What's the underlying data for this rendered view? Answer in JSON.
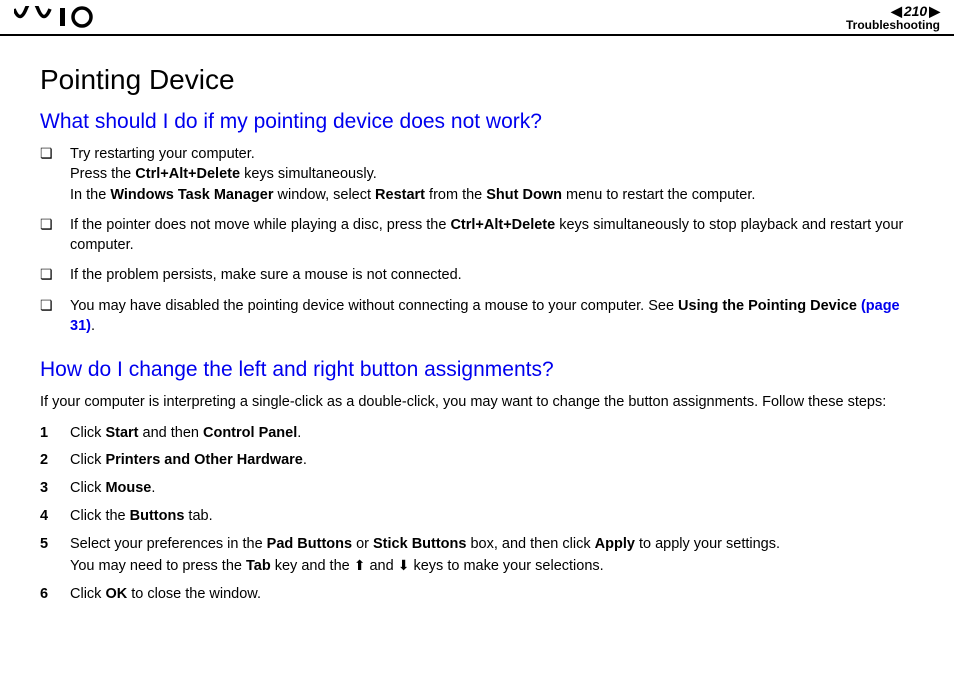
{
  "header": {
    "logo_alt": "VAIO",
    "page_number": "210",
    "section": "Troubleshooting"
  },
  "h1": "Pointing Device",
  "q1": {
    "heading": "What should I do if my pointing device does not work?",
    "items": [
      {
        "line1": "Try restarting your computer.",
        "line2_pre": "Press the ",
        "line2_b1": "Ctrl+Alt+Delete",
        "line2_post": " keys simultaneously.",
        "line3_pre": "In the ",
        "line3_b1": "Windows Task Manager",
        "line3_mid1": " window, select ",
        "line3_b2": "Restart",
        "line3_mid2": " from the ",
        "line3_b3": "Shut Down",
        "line3_post": " menu to restart the computer."
      },
      {
        "pre": "If the pointer does not move while playing a disc, press the ",
        "b1": "Ctrl+Alt+Delete",
        "post": " keys simultaneously to stop playback and restart your computer."
      },
      {
        "text": "If the problem persists, make sure a mouse is not connected."
      },
      {
        "pre": "You may have disabled the pointing device without connecting a mouse to your computer. See ",
        "b1": "Using the Pointing Device ",
        "link": "(page 31)",
        "post": "."
      }
    ]
  },
  "q2": {
    "heading": "How do I change the left and right button assignments?",
    "intro": "If your computer is interpreting a single-click as a double-click, you may want to change the button assignments. Follow these steps:",
    "steps": [
      {
        "n": "1",
        "pre": "Click ",
        "b1": "Start",
        "mid": " and then ",
        "b2": "Control Panel",
        "post": "."
      },
      {
        "n": "2",
        "pre": "Click ",
        "b1": "Printers and Other Hardware",
        "post": "."
      },
      {
        "n": "3",
        "pre": "Click ",
        "b1": "Mouse",
        "post": "."
      },
      {
        "n": "4",
        "pre": "Click the ",
        "b1": "Buttons",
        "post": " tab."
      },
      {
        "n": "5",
        "pre": "Select your preferences in the ",
        "b1": "Pad Buttons",
        "mid1": " or ",
        "b2": "Stick Buttons",
        "mid2": " box, and then click ",
        "b3": "Apply",
        "post1": " to apply your settings.",
        "line2_pre": "You may need to press the ",
        "line2_b1": "Tab",
        "line2_mid": " key and the ",
        "line2_up": "⬆",
        "line2_and": " and ",
        "line2_down": "⬇",
        "line2_post": " keys to make your selections."
      },
      {
        "n": "6",
        "pre": "Click ",
        "b1": "OK",
        "post": " to close the window."
      }
    ]
  }
}
